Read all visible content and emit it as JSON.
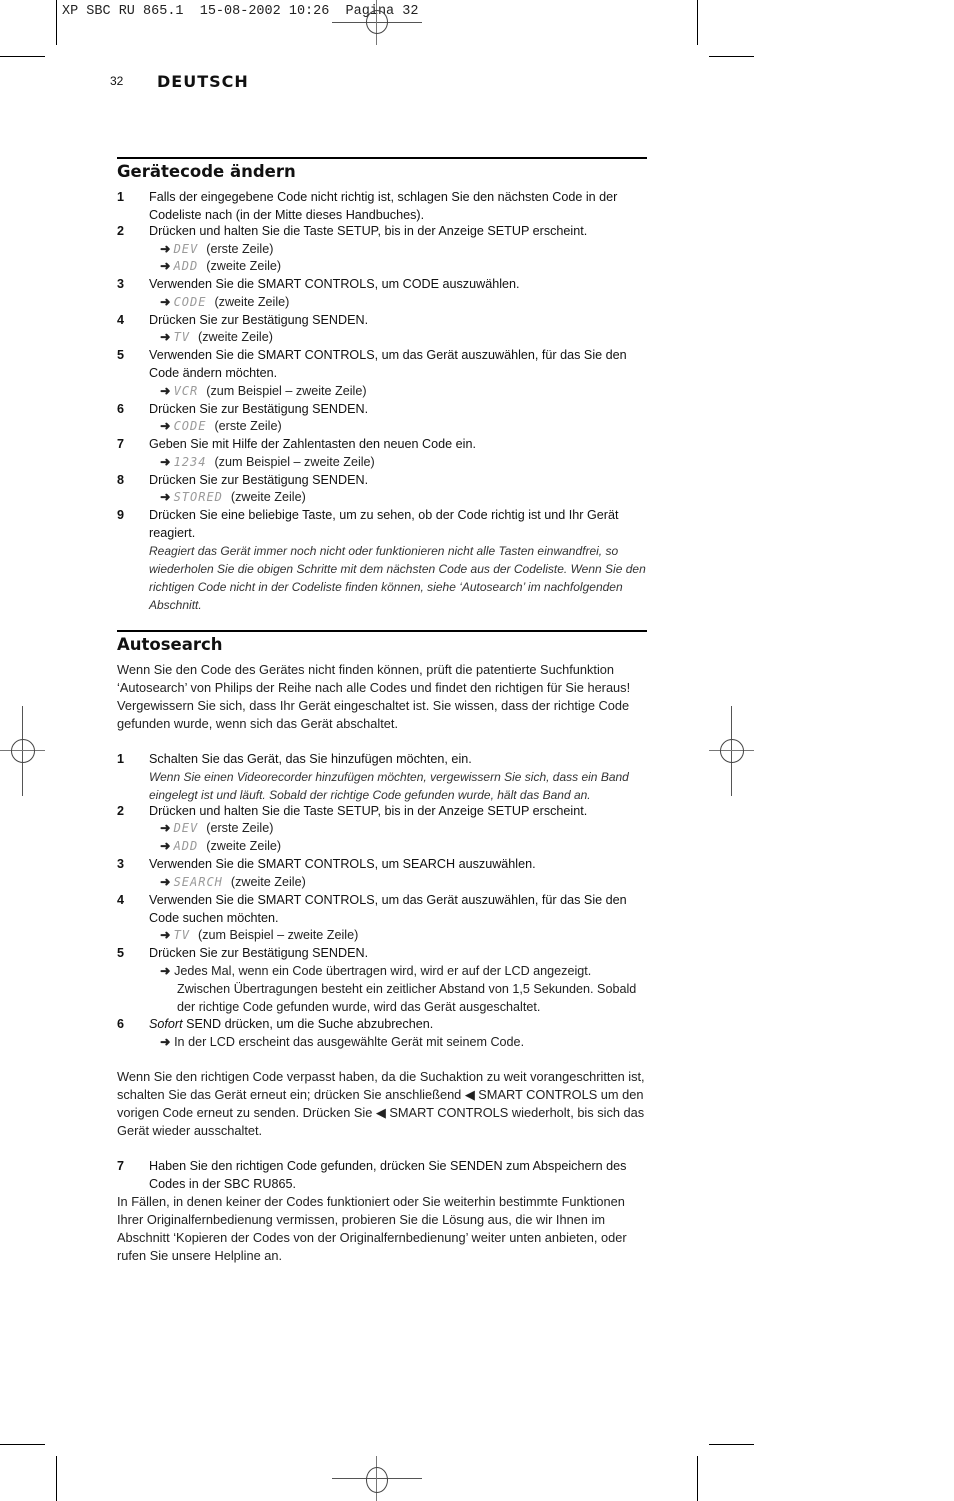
{
  "slug": "XP SBC RU 865.1  15-08-2002 10:26  Pagina 32",
  "header": {
    "page_number": "32",
    "language": "DEUTSCH"
  },
  "section1": {
    "title": "Gerätecode ändern",
    "steps": [
      {
        "num": "1",
        "text": "Falls der eingegebene Code nicht richtig ist, schlagen Sie den nächsten Code in der Codeliste nach (in der Mitte dieses Handbuches)."
      },
      {
        "num": "2",
        "text": "Drücken und halten Sie die Taste SETUP, bis in der Anzeige SETUP erscheint.",
        "results": [
          {
            "lcd": "DEV",
            "note": "(erste Zeile)"
          },
          {
            "lcd": "ADD",
            "note": "(zweite Zeile)"
          }
        ]
      },
      {
        "num": "3",
        "text": "Verwenden Sie die SMART CONTROLS, um CODE auszuwählen.",
        "results": [
          {
            "lcd": "CODE",
            "note": "(zweite Zeile)"
          }
        ]
      },
      {
        "num": "4",
        "text": "Drücken Sie zur Bestätigung SENDEN.",
        "results": [
          {
            "lcd": "TV",
            "note": "(zweite Zeile)"
          }
        ]
      },
      {
        "num": "5",
        "text": "Verwenden Sie die SMART CONTROLS, um das Gerät auszuwählen, für das Sie den Code ändern möchten.",
        "results": [
          {
            "lcd": "VCR",
            "note": "(zum Beispiel – zweite Zeile)"
          }
        ]
      },
      {
        "num": "6",
        "text": "Drücken Sie zur Bestätigung SENDEN.",
        "results": [
          {
            "lcd": "CODE",
            "note": "(erste Zeile)"
          }
        ]
      },
      {
        "num": "7",
        "text": "Geben Sie mit Hilfe der Zahlentasten den neuen Code ein.",
        "results": [
          {
            "lcd": "1234",
            "note": "(zum Beispiel – zweite Zeile)"
          }
        ]
      },
      {
        "num": "8",
        "text": "Drücken Sie zur Bestätigung SENDEN.",
        "results": [
          {
            "lcd": "STORED",
            "note": "(zweite Zeile)"
          }
        ]
      },
      {
        "num": "9",
        "text": "Drücken Sie eine beliebige Taste, um zu sehen, ob der Code richtig ist und Ihr Gerät reagiert.",
        "note": "Reagiert das Gerät immer noch nicht oder funktionieren nicht alle Tasten einwandfrei, so wiederholen Sie die obigen Schritte mit dem nächsten Code aus der Codeliste. Wenn Sie den richtigen Code nicht in der Codeliste finden können, siehe ‘Autosearch’ im nachfolgenden Abschnitt."
      }
    ]
  },
  "section2": {
    "title": "Autosearch",
    "intro": "Wenn Sie den Code des Gerätes nicht finden können, prüft die patentierte Suchfunktion ‘Autosearch’ von Philips der Reihe nach alle Codes und findet den richtigen für Sie heraus! Vergewissern Sie sich, dass Ihr Gerät eingeschaltet ist. Sie wissen, dass der richtige Code gefunden wurde, wenn sich das Gerät abschaltet.",
    "steps": [
      {
        "num": "1",
        "text": "Schalten Sie das Gerät, das Sie hinzufügen möchten, ein.",
        "note": "Wenn Sie einen Videorecorder hinzufügen möchten, vergewissern Sie sich, dass ein Band eingelegt ist und läuft. Sobald der richtige Code gefunden wurde, hält das Band an."
      },
      {
        "num": "2",
        "text": "Drücken und halten Sie die Taste SETUP, bis in der Anzeige SETUP erscheint.",
        "results": [
          {
            "lcd": "DEV",
            "note": "(erste Zeile)"
          },
          {
            "lcd": "ADD",
            "note": "(zweite Zeile)"
          }
        ]
      },
      {
        "num": "3",
        "text": "Verwenden Sie die SMART CONTROLS, um SEARCH auszuwählen.",
        "results": [
          {
            "lcd": "SEARCH",
            "note": "(zweite Zeile)"
          }
        ]
      },
      {
        "num": "4",
        "text": "Verwenden Sie die SMART CONTROLS, um das Gerät auszuwählen, für das Sie den Code suchen möchten.",
        "results": [
          {
            "lcd": "TV",
            "note": "(zum Beispiel – zweite Zeile)"
          }
        ]
      },
      {
        "num": "5",
        "text": "Drücken Sie zur Bestätigung SENDEN.",
        "result_text": "Jedes Mal, wenn ein Code übertragen wird, wird er auf der LCD angezeigt. Zwischen Übertragungen besteht ein zeitlicher Abstand von 1,5 Sekunden. Sobald der richtige Code gefunden wurde, wird das Gerät ausgeschaltet."
      },
      {
        "num": "6",
        "text_italic": "Sofort",
        "text": " SEND drücken, um die Suche abzubrechen.",
        "result_text": "In der LCD erscheint das ausgewählte Gerät mit seinem Code."
      }
    ],
    "missed_para": "Wenn Sie den richtigen Code verpasst haben, da die Suchaktion zu weit vorangeschritten ist, schalten Sie das Gerät erneut ein; drücken Sie anschließend ◀ SMART CONTROLS um den vorigen Code erneut zu senden. Drücken Sie ◀ SMART CONTROLS wiederholt, bis sich das Gerät wieder ausschaltet.",
    "step7": {
      "num": "7",
      "text": "Haben Sie den richtigen Code gefunden, drücken Sie SENDEN zum Abspeichern des Codes in der SBC RU865."
    },
    "closing": "In Fällen, in denen keiner der Codes funktioniert oder Sie weiterhin bestimmte Funktionen Ihrer Originalfernbedienung vermissen, probieren Sie die Lösung aus, die wir Ihnen im Abschnitt ‘Kopieren der Codes von der Originalfernbedienung’ weiter unten anbieten, oder rufen Sie unsere Helpline an."
  },
  "glyphs": {
    "arrow": "➜"
  }
}
